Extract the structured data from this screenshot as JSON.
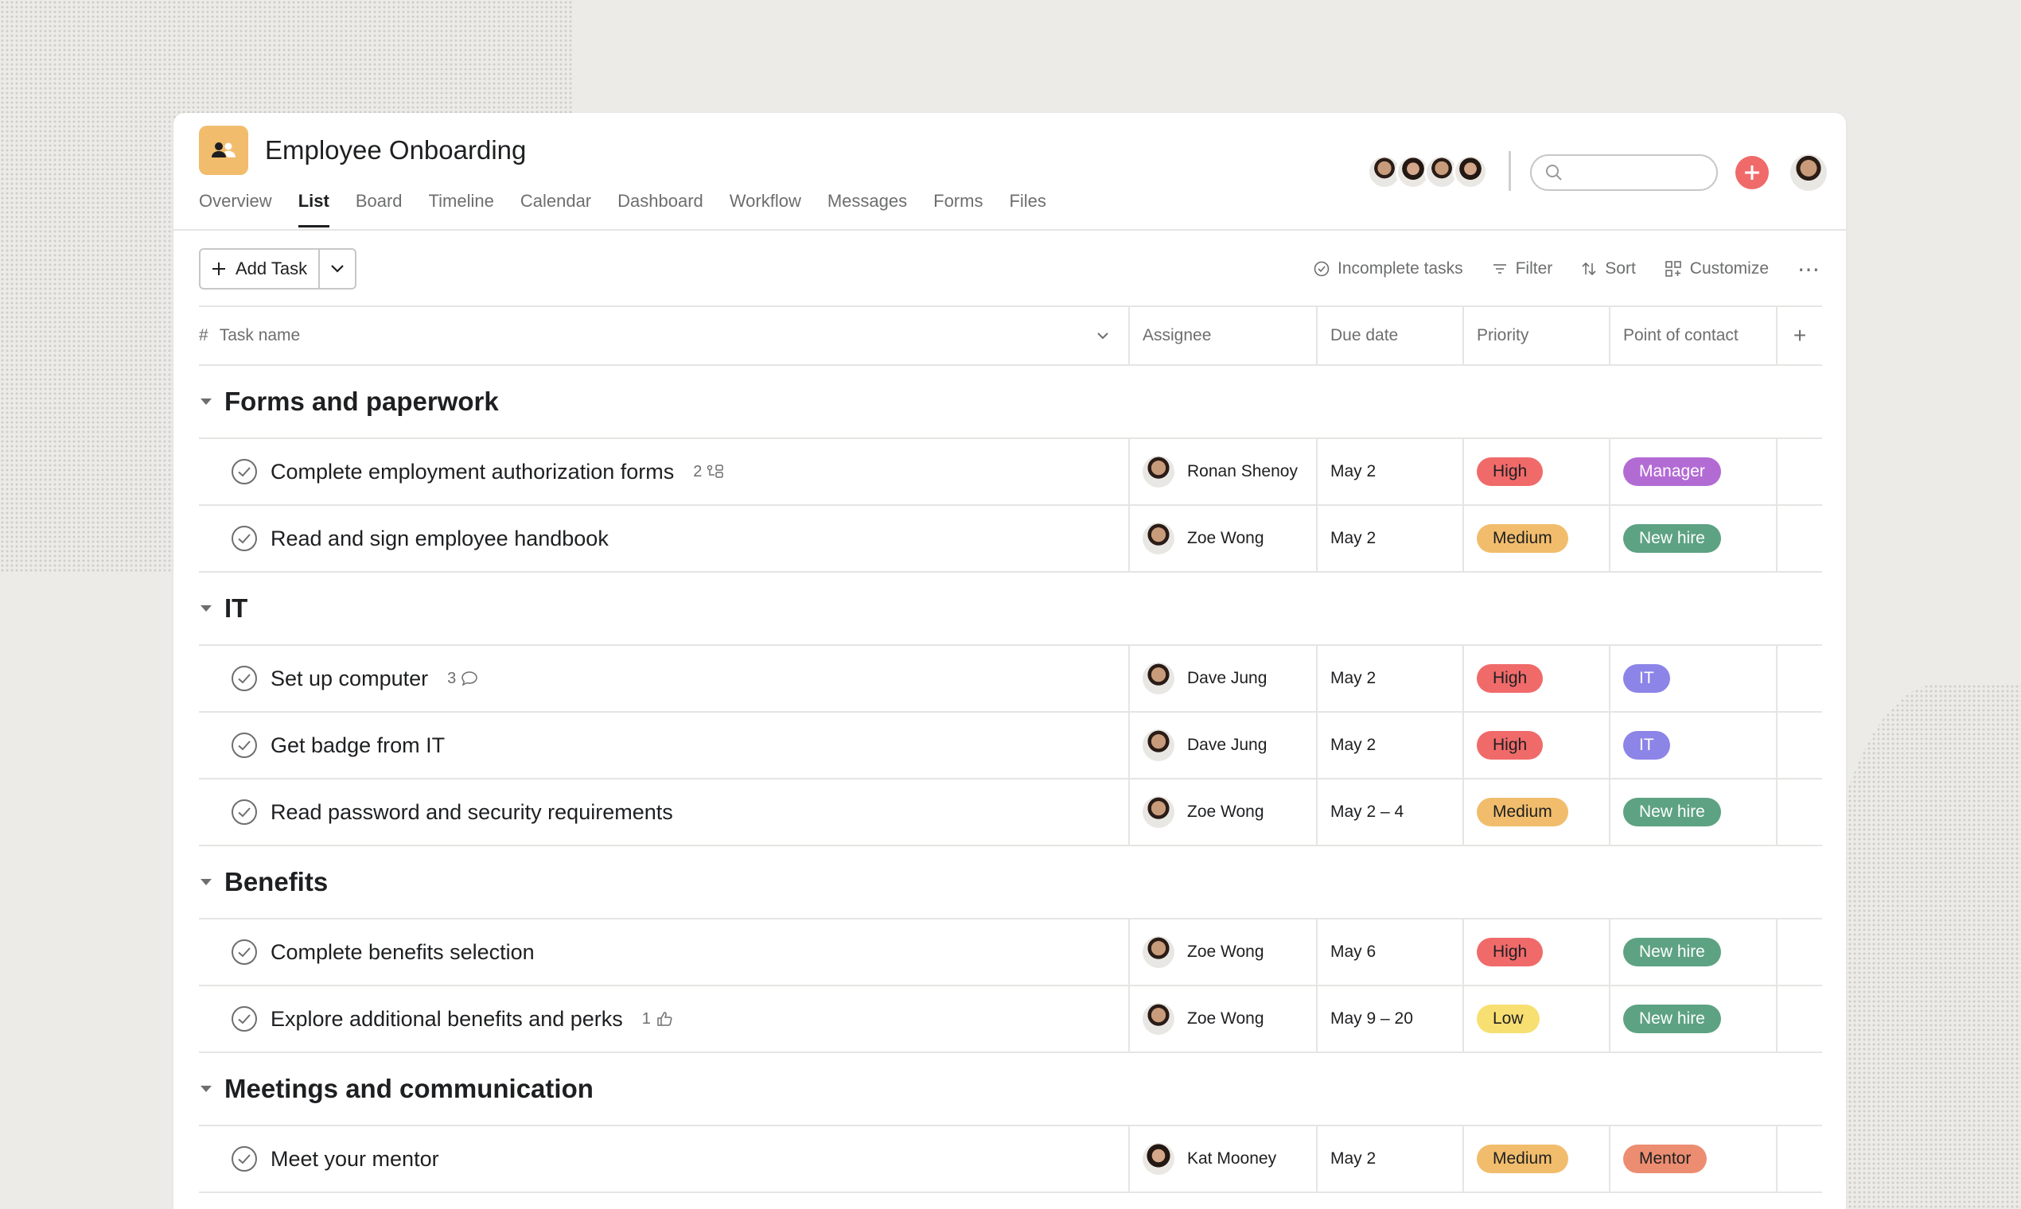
{
  "project": {
    "title": "Employee Onboarding",
    "icon": "people-icon",
    "color": "#f1bd6c"
  },
  "tabs": [
    {
      "label": "Overview",
      "active": false
    },
    {
      "label": "List",
      "active": true
    },
    {
      "label": "Board",
      "active": false
    },
    {
      "label": "Timeline",
      "active": false
    },
    {
      "label": "Calendar",
      "active": false
    },
    {
      "label": "Dashboard",
      "active": false
    },
    {
      "label": "Workflow",
      "active": false
    },
    {
      "label": "Messages",
      "active": false
    },
    {
      "label": "Forms",
      "active": false
    },
    {
      "label": "Files",
      "active": false
    }
  ],
  "search": {
    "placeholder": ""
  },
  "toolbar": {
    "add_task_label": "Add Task",
    "incomplete_label": "Incomplete tasks",
    "filter_label": "Filter",
    "sort_label": "Sort",
    "customize_label": "Customize",
    "more_label": "⋯"
  },
  "columns": {
    "hash": "#",
    "task": "Task name",
    "assignee": "Assignee",
    "due": "Due date",
    "priority": "Priority",
    "poc": "Point of contact",
    "add": "+"
  },
  "sections": [
    {
      "name": "Forms and paperwork",
      "tasks": [
        {
          "name": "Complete employment authorization forms",
          "meta_count": "2",
          "meta_icon": "subtask-icon",
          "assignee": "Ronan Shenoy",
          "due": "May 2",
          "priority": "High",
          "poc": "Manager"
        },
        {
          "name": "Read and sign employee handbook",
          "meta_count": "",
          "meta_icon": "",
          "assignee": "Zoe Wong",
          "due": "May 2",
          "priority": "Medium",
          "poc": "New hire"
        }
      ]
    },
    {
      "name": "IT",
      "tasks": [
        {
          "name": "Set up computer",
          "meta_count": "3",
          "meta_icon": "comment-icon",
          "assignee": "Dave Jung",
          "due": "May 2",
          "priority": "High",
          "poc": "IT"
        },
        {
          "name": "Get badge from IT",
          "meta_count": "",
          "meta_icon": "",
          "assignee": "Dave Jung",
          "due": "May 2",
          "priority": "High",
          "poc": "IT"
        },
        {
          "name": "Read password and security requirements",
          "meta_count": "",
          "meta_icon": "",
          "assignee": "Zoe Wong",
          "due": "May 2 – 4",
          "priority": "Medium",
          "poc": "New hire"
        }
      ]
    },
    {
      "name": "Benefits",
      "tasks": [
        {
          "name": "Complete benefits selection",
          "meta_count": "",
          "meta_icon": "",
          "assignee": "Zoe Wong",
          "due": "May 6",
          "priority": "High",
          "poc": "New hire"
        },
        {
          "name": "Explore additional benefits and perks",
          "meta_count": "1",
          "meta_icon": "like-icon",
          "assignee": "Zoe Wong",
          "due": "May 9 – 20",
          "priority": "Low",
          "poc": "New hire"
        }
      ]
    },
    {
      "name": "Meetings and communication",
      "tasks": [
        {
          "name": "Meet your mentor",
          "meta_count": "",
          "meta_icon": "",
          "assignee": "Kat Mooney",
          "due": "May 2",
          "priority": "Medium",
          "poc": "Mentor"
        }
      ]
    }
  ],
  "colors": {
    "high": "#f06a6a",
    "medium": "#f1bd6c",
    "low": "#f8df72",
    "manager": "#b36bd4",
    "new_hire": "#5da283",
    "it": "#8d84e8",
    "mentor": "#ec8d71",
    "add_button": "#f06a6a"
  }
}
